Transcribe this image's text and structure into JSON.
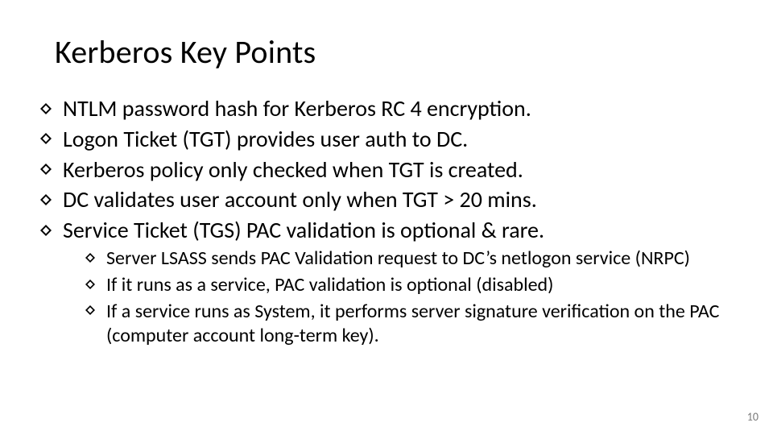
{
  "title": "Kerberos Key Points",
  "bullets": [
    "NTLM password hash for Kerberos RC 4 encryption.",
    "Logon Ticket (TGT) provides user auth to DC.",
    "Kerberos policy only checked when TGT is created.",
    "DC validates user account only when TGT > 20 mins.",
    "Service Ticket (TGS) PAC validation is optional & rare."
  ],
  "sub_bullets": [
    "Server LSASS sends PAC Validation request to DC’s netlogon service (NRPC)",
    "If it runs as a service, PAC validation is optional (disabled)",
    "If a service runs as System, it performs server signature verification on the PAC (computer account long-term key)."
  ],
  "page_number": "10"
}
